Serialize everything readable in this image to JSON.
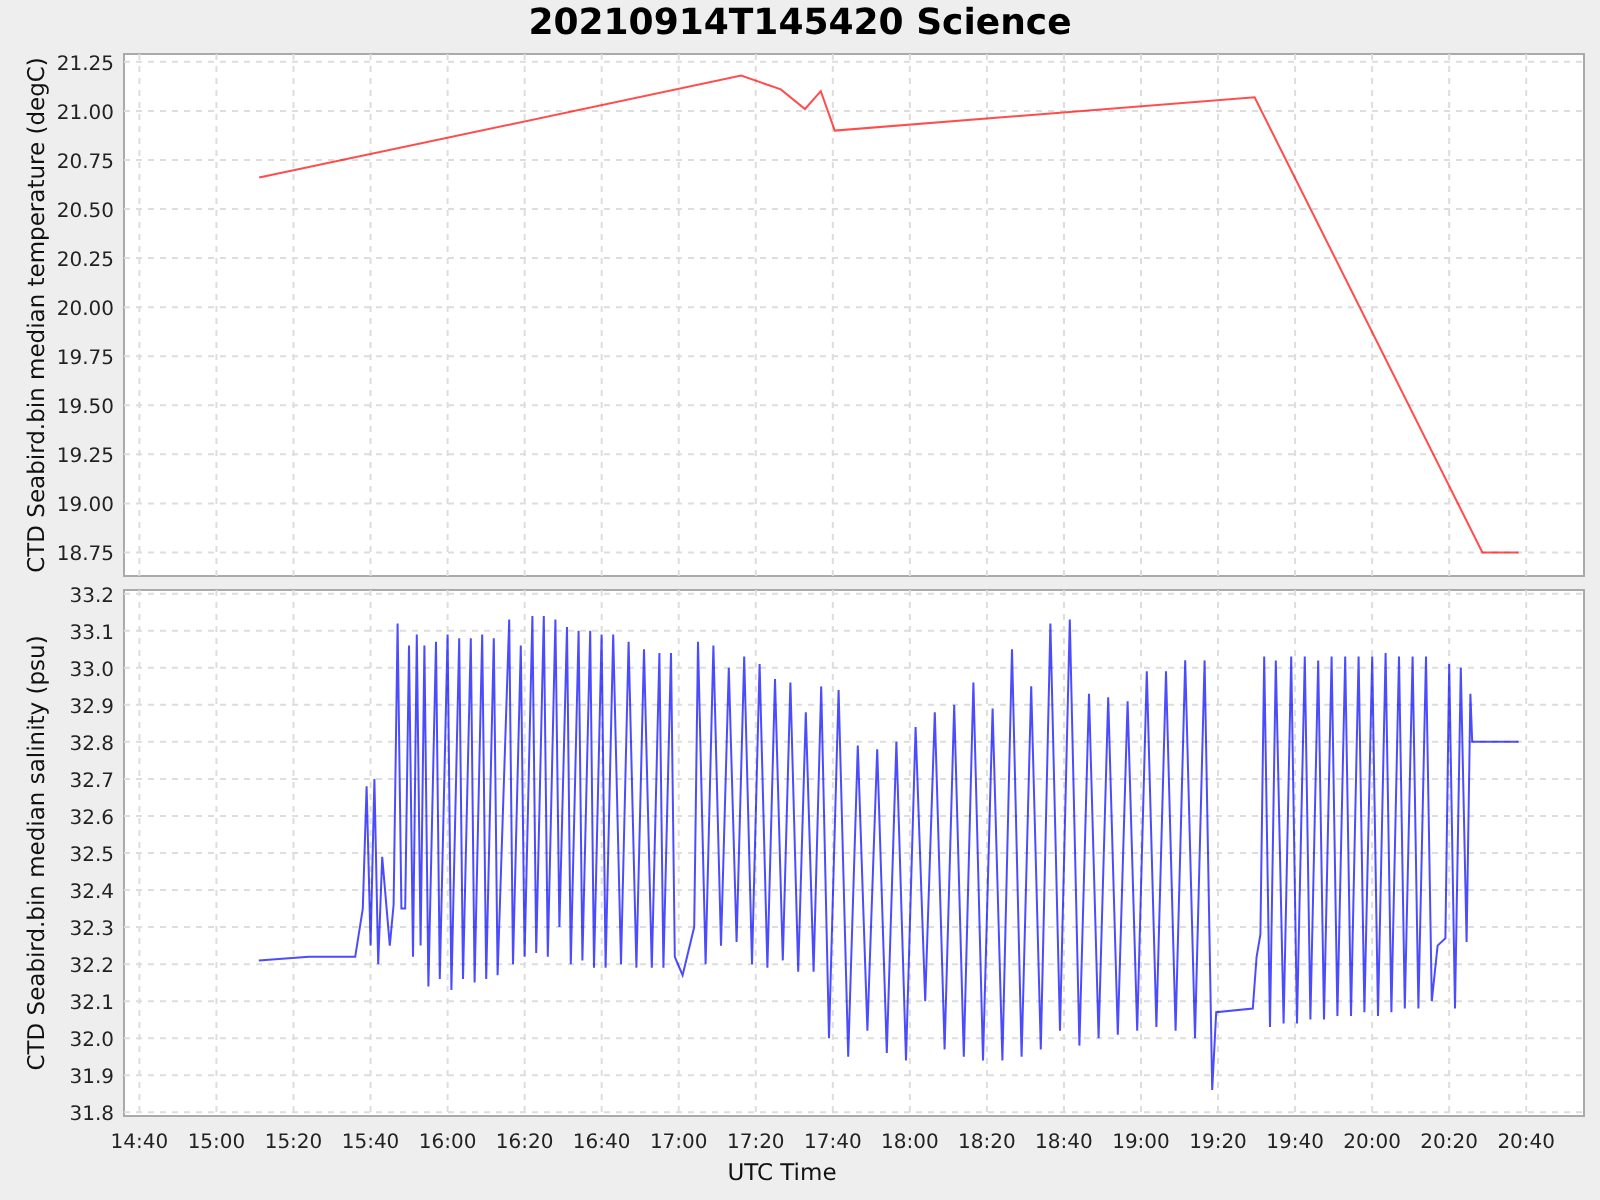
{
  "title": "20210914T145420 Science",
  "panels": [
    {
      "chart_data": {
        "type": "line",
        "grid": true,
        "ylabel": "CTD Seabird.bin median temperature (degC)",
        "xlim": [
          876,
          1255
        ],
        "ylim": [
          18.63,
          21.29
        ],
        "yticks": [
          {
            "value": 18.75,
            "label": "18.75"
          },
          {
            "value": 19,
            "label": "19.00"
          },
          {
            "value": 19.25,
            "label": "19.25"
          },
          {
            "value": 19.5,
            "label": "19.50"
          },
          {
            "value": 19.75,
            "label": "19.75"
          },
          {
            "value": 20,
            "label": "20.00"
          },
          {
            "value": 20.25,
            "label": "20.25"
          },
          {
            "value": 20.5,
            "label": "20.50"
          },
          {
            "value": 20.75,
            "label": "20.75"
          },
          {
            "value": 21,
            "label": "21.00"
          },
          {
            "value": 21.25,
            "label": "21.25"
          }
        ],
        "x": [
          911.1,
          1036.2,
          1046.5,
          1052.8,
          1056.9,
          1060.5,
          1169.5,
          1228.6,
          1238
        ],
        "series": [
          {
            "color": "#ff0000",
            "values": [
              20.66,
              21.18,
              21.11,
              21.01,
              21.1,
              20.9,
              21.07,
              18.75,
              18.75
            ]
          }
        ]
      }
    },
    {
      "chart_data": {
        "type": "line",
        "grid": true,
        "xlabel": "UTC Time",
        "ylabel": "CTD Seabird.bin median salinity (psu)",
        "xlim": [
          876,
          1255
        ],
        "ylim": [
          31.79,
          33.21
        ],
        "xticks": [
          {
            "value": 880,
            "label": "14:40"
          },
          {
            "value": 900,
            "label": "15:00"
          },
          {
            "value": 920,
            "label": "15:20"
          },
          {
            "value": 940,
            "label": "15:40"
          },
          {
            "value": 960,
            "label": "16:00"
          },
          {
            "value": 980,
            "label": "16:20"
          },
          {
            "value": 1000,
            "label": "16:40"
          },
          {
            "value": 1020,
            "label": "17:00"
          },
          {
            "value": 1040,
            "label": "17:20"
          },
          {
            "value": 1060,
            "label": "17:40"
          },
          {
            "value": 1080,
            "label": "18:00"
          },
          {
            "value": 1100,
            "label": "18:20"
          },
          {
            "value": 1120,
            "label": "18:40"
          },
          {
            "value": 1140,
            "label": "19:00"
          },
          {
            "value": 1160,
            "label": "19:20"
          },
          {
            "value": 1180,
            "label": "19:40"
          },
          {
            "value": 1200,
            "label": "20:00"
          },
          {
            "value": 1220,
            "label": "20:20"
          },
          {
            "value": 1240,
            "label": "20:40"
          }
        ],
        "yticks": [
          {
            "value": 31.8,
            "label": "31.8"
          },
          {
            "value": 31.9,
            "label": "31.9"
          },
          {
            "value": 32,
            "label": "32.0"
          },
          {
            "value": 32.1,
            "label": "32.1"
          },
          {
            "value": 32.2,
            "label": "32.2"
          },
          {
            "value": 32.3,
            "label": "32.3"
          },
          {
            "value": 32.4,
            "label": "32.4"
          },
          {
            "value": 32.5,
            "label": "32.5"
          },
          {
            "value": 32.6,
            "label": "32.6"
          },
          {
            "value": 32.7,
            "label": "32.7"
          },
          {
            "value": 32.8,
            "label": "32.8"
          },
          {
            "value": 32.9,
            "label": "32.9"
          },
          {
            "value": 33,
            "label": "33.0"
          },
          {
            "value": 33.1,
            "label": "33.1"
          },
          {
            "value": 33.2,
            "label": "33.2"
          }
        ],
        "x": [
          911,
          924,
          936,
          938,
          939,
          940,
          941,
          942,
          943,
          945,
          946,
          947,
          948,
          949,
          950,
          951,
          952,
          953,
          954,
          955,
          957,
          958,
          960,
          961,
          963,
          964,
          966,
          967,
          969,
          970,
          972,
          973,
          976,
          977,
          979,
          980,
          982,
          983,
          985,
          986,
          988,
          989,
          991,
          992,
          994,
          995,
          997,
          998,
          1000,
          1001,
          1003,
          1005,
          1007,
          1009,
          1011,
          1013,
          1015,
          1016,
          1018,
          1019,
          1021,
          1024,
          1025,
          1027,
          1029,
          1031,
          1033,
          1035,
          1037,
          1039,
          1041,
          1043,
          1045,
          1047,
          1049,
          1051,
          1053,
          1055,
          1057,
          1059,
          1061.5,
          1064,
          1066.5,
          1069,
          1071.5,
          1074,
          1076.5,
          1079,
          1081.5,
          1084,
          1086.5,
          1089,
          1091.5,
          1094,
          1096.5,
          1099,
          1101.5,
          1104,
          1106.5,
          1109,
          1111.5,
          1114,
          1116.5,
          1119,
          1121.5,
          1124,
          1126.5,
          1129,
          1131.5,
          1134,
          1136.5,
          1139,
          1141.5,
          1144,
          1146.5,
          1149,
          1151.5,
          1154,
          1156.5,
          1158.5,
          1159.5,
          1169,
          1170,
          1171,
          1172,
          1173.5,
          1175,
          1177,
          1179,
          1180.5,
          1182.5,
          1184,
          1186,
          1187.5,
          1189.5,
          1191,
          1193,
          1194.5,
          1196.5,
          1198,
          1200,
          1201.5,
          1203.5,
          1205,
          1207,
          1208.5,
          1210.5,
          1212,
          1214,
          1215.5,
          1217,
          1219,
          1220,
          1221.5,
          1223,
          1224.5,
          1225.5,
          1226,
          1227,
          1238
        ],
        "series": [
          {
            "color": "#0000ff",
            "values": [
              32.21,
              32.22,
              32.22,
              32.35,
              32.68,
              32.25,
              32.7,
              32.2,
              32.49,
              32.25,
              32.36,
              33.12,
              32.35,
              32.35,
              33.06,
              32.22,
              33.09,
              32.25,
              33.06,
              32.14,
              33.07,
              32.16,
              33.09,
              32.13,
              33.08,
              32.16,
              33.08,
              32.15,
              33.09,
              32.16,
              33.08,
              32.17,
              33.13,
              32.2,
              33.06,
              32.22,
              33.14,
              32.23,
              33.14,
              32.22,
              33.13,
              32.3,
              33.11,
              32.2,
              33.1,
              32.21,
              33.1,
              32.19,
              33.09,
              32.19,
              33.09,
              32.2,
              33.07,
              32.19,
              33.05,
              32.19,
              33.04,
              32.19,
              33.04,
              32.22,
              32.17,
              32.3,
              33.07,
              32.2,
              33.06,
              32.25,
              33.0,
              32.26,
              33.03,
              32.2,
              33.01,
              32.19,
              32.97,
              32.21,
              32.96,
              32.18,
              32.88,
              32.18,
              32.95,
              32.0,
              32.94,
              31.95,
              32.79,
              32.02,
              32.78,
              31.96,
              32.8,
              31.94,
              32.84,
              32.1,
              32.88,
              31.97,
              32.9,
              31.95,
              32.96,
              31.94,
              32.89,
              31.94,
              33.05,
              31.95,
              32.95,
              31.97,
              33.12,
              32.02,
              33.13,
              31.98,
              32.93,
              32.0,
              32.92,
              32.01,
              32.91,
              32.02,
              32.99,
              32.03,
              32.99,
              32.02,
              33.02,
              32.0,
              33.02,
              31.86,
              32.07,
              32.08,
              32.22,
              32.28,
              33.03,
              32.03,
              33.02,
              32.04,
              33.03,
              32.04,
              33.03,
              32.05,
              33.02,
              32.05,
              33.03,
              32.06,
              33.03,
              32.06,
              33.03,
              32.07,
              33.03,
              32.06,
              33.04,
              32.07,
              33.03,
              32.08,
              33.03,
              32.08,
              33.03,
              32.1,
              32.25,
              32.27,
              33.01,
              32.08,
              33.0,
              32.26,
              32.93,
              32.8,
              32.8,
              32.8
            ]
          }
        ]
      }
    }
  ]
}
